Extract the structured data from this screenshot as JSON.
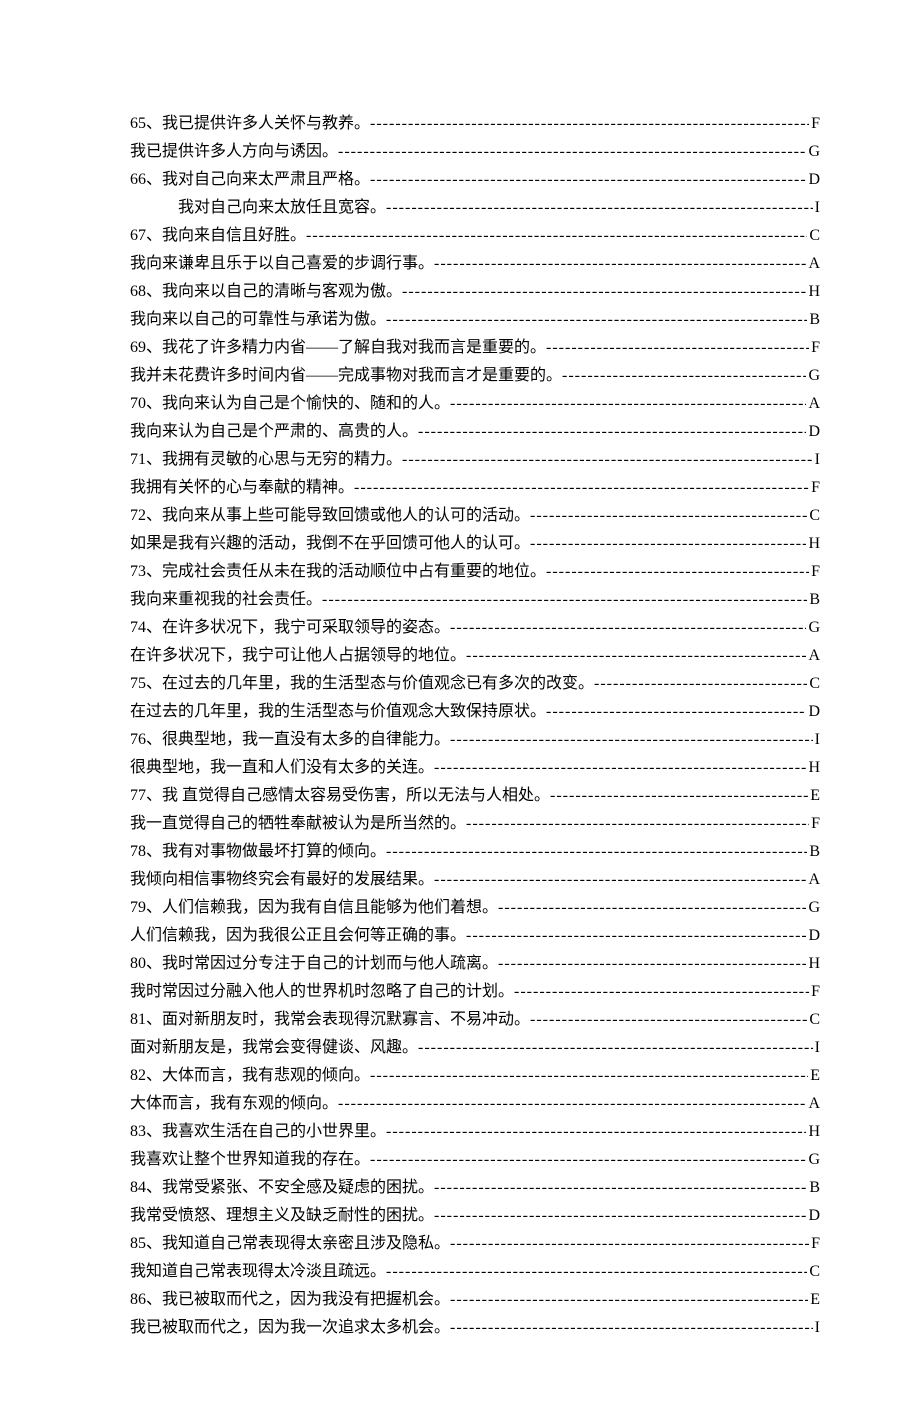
{
  "items": [
    {
      "num": "65、",
      "text": "我已提供许多人关怀与教养。",
      "code": "F",
      "indent": false
    },
    {
      "num": "",
      "text": "我已提供许多人方向与诱因。",
      "code": "G",
      "indent": false
    },
    {
      "num": "66、",
      "text": "我对自己向来太严肃且严格。",
      "code": "D",
      "indent": false
    },
    {
      "num": "",
      "text": "我对自己向来太放任且宽容。",
      "code": "I",
      "indent": true
    },
    {
      "num": "67、",
      "text": "我向来自信且好胜。",
      "code": "C",
      "indent": false
    },
    {
      "num": "",
      "text": "我向来谦卑且乐于以自己喜爱的步调行事。",
      "code": "A",
      "indent": false
    },
    {
      "num": "68、",
      "text": "我向来以自己的清晰与客观为傲。",
      "code": "H",
      "indent": false
    },
    {
      "num": "",
      "text": "我向来以自己的可靠性与承诺为傲。",
      "code": "B",
      "indent": false
    },
    {
      "num": "69、",
      "text": "我花了许多精力内省——了解自我对我而言是重要的。",
      "code": "F",
      "indent": false
    },
    {
      "num": "",
      "text": "我并未花费许多时间内省——完成事物对我而言才是重要的。",
      "code": "G",
      "indent": false
    },
    {
      "num": "70、",
      "text": "我向来认为自己是个愉快的、随和的人。",
      "code": "A",
      "indent": false
    },
    {
      "num": "",
      "text": "我向来认为自己是个严肃的、高贵的人。",
      "code": "D",
      "indent": false
    },
    {
      "num": "71、",
      "text": "我拥有灵敏的心思与无穷的精力。",
      "code": "I",
      "indent": false
    },
    {
      "num": "",
      "text": "我拥有关怀的心与奉献的精神。",
      "code": "F",
      "indent": false
    },
    {
      "num": "72、",
      "text": "我向来从事上些可能导致回馈或他人的认可的活动。",
      "code": "C",
      "indent": false
    },
    {
      "num": "",
      "text": "如果是我有兴趣的活动，我倒不在乎回馈可他人的认可。",
      "code": "H",
      "indent": false
    },
    {
      "num": "73、",
      "text": "完成社会责任从未在我的活动顺位中占有重要的地位。",
      "code": "F",
      "indent": false
    },
    {
      "num": "",
      "text": "我向来重视我的社会责任。",
      "code": "B",
      "indent": false
    },
    {
      "num": "74、",
      "text": "在许多状况下，我宁可采取领导的姿态。",
      "code": "G",
      "indent": false
    },
    {
      "num": "",
      "text": "在许多状况下，我宁可让他人占据领导的地位。",
      "code": "A",
      "indent": false
    },
    {
      "num": "75、",
      "text": "在过去的几年里，我的生活型态与价值观念已有多次的改变。",
      "code": "C",
      "indent": false
    },
    {
      "num": "",
      "text": "在过去的几年里，我的生活型态与价值观念大致保持原状。",
      "code": "D",
      "indent": false
    },
    {
      "num": "76、",
      "text": "很典型地，我一直没有太多的自律能力。",
      "code": "I",
      "indent": false
    },
    {
      "num": "",
      "text": "很典型地，我一直和人们没有太多的关连。",
      "code": "H",
      "indent": false
    },
    {
      "num": "77、",
      "text": "我 直觉得自己感情太容易受伤害，所以无法与人相处。",
      "code": "E",
      "indent": false
    },
    {
      "num": "",
      "text": "我一直觉得自己的牺牲奉献被认为是所当然的。",
      "code": "F",
      "indent": false
    },
    {
      "num": "78、",
      "text": "我有对事物做最坏打算的倾向。",
      "code": "B",
      "indent": false
    },
    {
      "num": "",
      "text": "我倾向相信事物终究会有最好的发展结果。",
      "code": "A",
      "indent": false
    },
    {
      "num": "79、",
      "text": "人们信赖我，因为我有自信且能够为他们着想。",
      "code": "G",
      "indent": false
    },
    {
      "num": "",
      "text": "人们信赖我，因为我很公正且会何等正确的事。",
      "code": "D",
      "indent": false
    },
    {
      "num": "80、",
      "text": "我时常因过分专注于自己的计划而与他人疏离。",
      "code": "H",
      "indent": false
    },
    {
      "num": "",
      "text": "我时常因过分融入他人的世界机时忽略了自己的计划。",
      "code": "F",
      "indent": false
    },
    {
      "num": "81、",
      "text": "面对新朋友时，我常会表现得沉默寡言、不易冲动。",
      "code": "C",
      "indent": false
    },
    {
      "num": "",
      "text": "面对新朋友是，我常会变得健谈、风趣。",
      "code": "I",
      "indent": false
    },
    {
      "num": "82、",
      "text": "大体而言，我有悲观的倾向。",
      "code": "E",
      "indent": false
    },
    {
      "num": "",
      "text": "大体而言，我有东观的倾向。",
      "code": "A",
      "indent": false
    },
    {
      "num": "83、",
      "text": "我喜欢生活在自己的小世界里。",
      "code": "H",
      "indent": false
    },
    {
      "num": "",
      "text": "我喜欢让整个世界知道我的存在。",
      "code": "G",
      "indent": false
    },
    {
      "num": "84、",
      "text": "我常受紧张、不安全感及疑虑的困扰。",
      "code": "B",
      "indent": false
    },
    {
      "num": "",
      "text": "我常受愤怒、理想主义及缺乏耐性的困扰。",
      "code": "D",
      "indent": false
    },
    {
      "num": "85、",
      "text": "我知道自己常表现得太亲密且涉及隐私。",
      "code": "F",
      "indent": false
    },
    {
      "num": "",
      "text": "我知道自己常表现得太冷淡且疏远。",
      "code": "C",
      "indent": false
    },
    {
      "num": "86、",
      "text": "我已被取而代之，因为我没有把握机会。",
      "code": "E",
      "indent": false
    },
    {
      "num": "",
      "text": "我已被取而代之，因为我一次追求太多机会。",
      "code": "I",
      "indent": false
    }
  ]
}
